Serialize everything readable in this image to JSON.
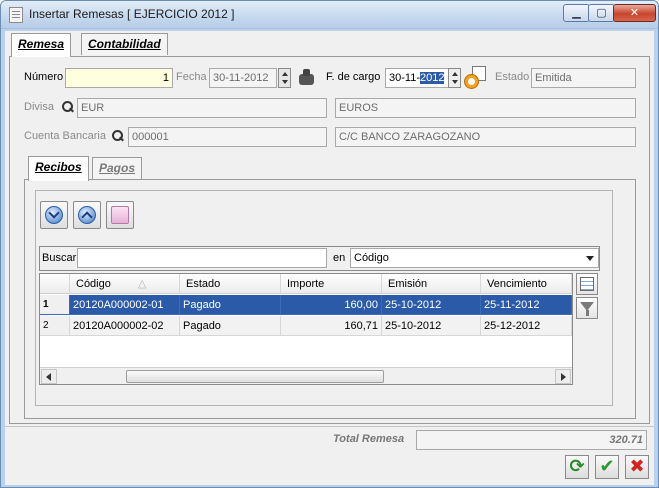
{
  "window": {
    "title": "Insertar Remesas [ EJERCICIO 2012 ]"
  },
  "tabs": [
    {
      "label": "Remesa"
    },
    {
      "label": "Contabilidad"
    }
  ],
  "header": {
    "numero_label": "Número",
    "numero_value": "1",
    "fecha_label": "Fecha",
    "fecha_value": "30-11-2012",
    "fcargo_label": "F. de cargo",
    "fcargo_value_prefix": "30-11-",
    "fcargo_value_selected": "2012",
    "estado_label": "Estado",
    "estado_value": "Emitida",
    "divisa_label": "Divisa",
    "divisa_code": "EUR",
    "divisa_name": "EUROS",
    "cuenta_label": "Cuenta Bancaria",
    "cuenta_code": "000001",
    "cuenta_name": "C/C BANCO ZARAGOZANO"
  },
  "subtabs": [
    {
      "label": "Recibos"
    },
    {
      "label": "Pagos"
    }
  ],
  "search": {
    "label": "Buscar",
    "value": "",
    "en_label": "en",
    "field_value": "Código"
  },
  "grid": {
    "columns": [
      "Código",
      "Estado",
      "Importe",
      "Emisión",
      "Vencimiento"
    ],
    "rows": [
      {
        "num": "1",
        "codigo": "20120A000002-01",
        "estado": "Pagado",
        "importe": "160,00",
        "emision": "25-10-2012",
        "vencimiento": "25-11-2012"
      },
      {
        "num": "2",
        "codigo": "20120A000002-02",
        "estado": "Pagado",
        "importe": "160,71",
        "emision": "25-10-2012",
        "vencimiento": "25-12-2012"
      }
    ]
  },
  "footer": {
    "total_label": "Total Remesa",
    "total_value": "320.71"
  }
}
